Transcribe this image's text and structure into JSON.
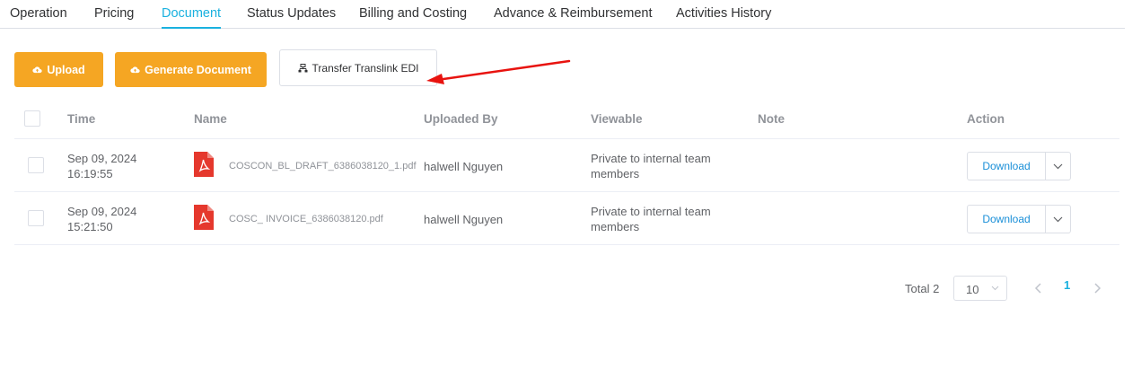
{
  "tabs": [
    {
      "label": "Operation"
    },
    {
      "label": "Pricing"
    },
    {
      "label": "Document",
      "active": true
    },
    {
      "label": "Status Updates"
    },
    {
      "label": "Billing and Costing"
    },
    {
      "label": "Advance & Reimbursement"
    },
    {
      "label": "Activities History"
    }
  ],
  "actions": {
    "upload_label": "Upload",
    "generate_label": "Generate Document",
    "transfer_label": "Transfer Translink EDI"
  },
  "table": {
    "headers": {
      "time": "Time",
      "name": "Name",
      "uploaded_by": "Uploaded By",
      "viewable": "Viewable",
      "note": "Note",
      "action": "Action"
    },
    "rows": [
      {
        "date": "Sep 09, 2024",
        "time": "16:19:55",
        "file": "COSCON_BL_DRAFT_6386038120_1.pdf",
        "uploaded_by": "halwell Nguyen",
        "viewable_line1": "Private to internal team",
        "viewable_line2": "members",
        "note": "",
        "download_label": "Download"
      },
      {
        "date": "Sep 09, 2024",
        "time": "15:21:50",
        "file": "COSC_ INVOICE_6386038120.pdf",
        "uploaded_by": "halwell Nguyen",
        "viewable_line1": "Private to internal team",
        "viewable_line2": "members",
        "note": "",
        "download_label": "Download"
      }
    ]
  },
  "pagination": {
    "total_label": "Total 2",
    "page_size": "10",
    "current_page": "1"
  },
  "colors": {
    "accent": "#1ab1df",
    "orange": "#f5a623",
    "pdf_red": "#e5382d",
    "annotation_red": "#e8130f"
  },
  "icons": {
    "upload": "cloud-upload-icon",
    "generate": "cloud-upload-icon",
    "transfer": "transfer-icon",
    "file": "pdf-file-icon",
    "dropdown": "chevron-down-icon"
  }
}
